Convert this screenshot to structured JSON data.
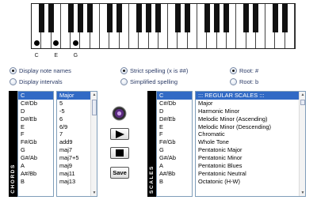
{
  "piano": {
    "white_keys": 27,
    "marked_white_key_indices": [
      0,
      2,
      4
    ],
    "labels": [
      "C",
      "E",
      "G"
    ]
  },
  "options": {
    "display_note_names": "Display note names",
    "display_intervals": "Display intervals",
    "strict_spelling": "Strict spelling (x is ##)",
    "simplified_spelling": "Simplified spelling",
    "root_sharp": "Root: #",
    "root_flat": "Root: b"
  },
  "chords_tab": "CHORDS",
  "scales_tab": "SCALES",
  "chord_roots": [
    "C",
    "C#/Db",
    "D",
    "D#/Eb",
    "E",
    "F",
    "F#/Gb",
    "G",
    "G#/Ab",
    "A",
    "A#/Bb",
    "B"
  ],
  "chord_types": [
    "Major",
    "5",
    "-5",
    "6",
    "6/9",
    "7",
    "add9",
    "maj7",
    "maj7+5",
    "maj9",
    "maj11",
    "maj13"
  ],
  "scale_roots": [
    "C",
    "C#/Db",
    "D",
    "D#/Eb",
    "E",
    "F",
    "F#/Gb",
    "G",
    "G#/Ab",
    "A",
    "A#/Bb",
    "B"
  ],
  "scale_types": [
    "::: REGULAR SCALES :::",
    "Major",
    "Harmonic Minor",
    "Melodic Minor (Ascending)",
    "Melodic Minor (Descending)",
    "Chromatic",
    "Whole Tone",
    "Pentatonic Major",
    "Pentatonic Minor",
    "Pentatonic Blues",
    "Pentatonic Neutral",
    "Octatonic (H-W)"
  ],
  "buttons": {
    "save": "Save"
  },
  "colors": {
    "selection": "#316ac5",
    "option_text": "#2a3a66",
    "tab_bg": "#000000"
  }
}
